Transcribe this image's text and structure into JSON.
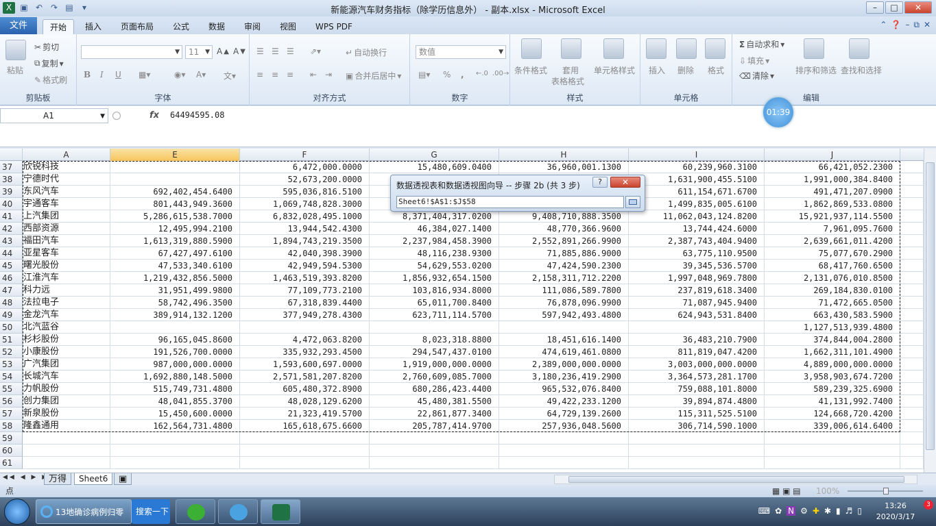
{
  "window": {
    "title": "新能源汽车财务指标（除学历信息外） - 副本.xlsx - Microsoft Excel",
    "min": "–",
    "max": "□",
    "close": "✕"
  },
  "ribbon_tabs": [
    "文件",
    "开始",
    "插入",
    "页面布局",
    "公式",
    "数据",
    "审阅",
    "视图",
    "WPS PDF"
  ],
  "ribbon": {
    "clipboard": {
      "label": "剪贴板",
      "paste": "粘贴",
      "cut": "剪切",
      "copy": "复制",
      "format_painter": "格式刷"
    },
    "font": {
      "label": "字体",
      "size": "11",
      "bold": "B",
      "italic": "I",
      "underline": "U"
    },
    "alignment": {
      "label": "对齐方式",
      "wrap": "自动换行",
      "merge": "合并后居中"
    },
    "number": {
      "label": "数字",
      "format": "数值",
      "percent": "%",
      "comma": ","
    },
    "styles": {
      "label": "样式",
      "conditional": "条件格式",
      "table_1": "套用",
      "table_2": "表格格式",
      "cell_styles": "单元格样式"
    },
    "cells": {
      "label": "单元格",
      "insert": "插入",
      "delete": "删除",
      "format": "格式"
    },
    "editing": {
      "label": "编辑",
      "autosum": "自动求和",
      "fill": "填充",
      "clear": "清除",
      "sort": "排序和筛选",
      "find": "查找和选择"
    }
  },
  "formula_bar": {
    "name_box": "A1",
    "fx": "fx",
    "value": "64494595.08"
  },
  "timer": "01:39",
  "columns": [
    "A",
    "E",
    "F",
    "G",
    "H",
    "I",
    "J"
  ],
  "rows": [
    {
      "n": "37",
      "name": "欣锐科技",
      "E": "",
      "F": "6,472,000.0000",
      "G": "15,480,609.0400",
      "H": "36,960,001.1300",
      "I": "60,239,960.3100",
      "J": "66,421,052.2300"
    },
    {
      "n": "38",
      "name": "宁德时代",
      "E": "",
      "F": "52,673,200.0000",
      "G": "",
      "H": "",
      "I": "1,631,900,455.5100",
      "J": "1,991,000,384.8400"
    },
    {
      "n": "39",
      "name": "东风汽车",
      "E": "692,402,454.6400",
      "F": "595,036,816.5100",
      "G": "",
      "H": "",
      "I": "611,154,671.6700",
      "J": "491,471,207.0900"
    },
    {
      "n": "40",
      "name": "宇通客车",
      "E": "801,443,949.3600",
      "F": "1,069,748,828.3000",
      "G": "",
      "H": "",
      "I": "1,499,835,005.6100",
      "J": "1,862,869,533.0800"
    },
    {
      "n": "41",
      "name": "上汽集团",
      "E": "5,286,615,538.7000",
      "F": "6,832,028,495.1000",
      "G": "8,371,404,317.0200",
      "H": "9,408,710,888.3500",
      "I": "11,062,043,124.8200",
      "J": "15,921,937,114.5500"
    },
    {
      "n": "42",
      "name": "西部资源",
      "E": "12,495,994.2100",
      "F": "13,944,542.4300",
      "G": "46,384,027.1400",
      "H": "48,770,366.9600",
      "I": "13,744,424.6000",
      "J": "7,961,095.7600"
    },
    {
      "n": "43",
      "name": "福田汽车",
      "E": "1,613,319,880.5900",
      "F": "1,894,743,219.3500",
      "G": "2,237,984,458.3900",
      "H": "2,552,891,266.9900",
      "I": "2,387,743,404.9400",
      "J": "2,639,661,011.4200"
    },
    {
      "n": "44",
      "name": "亚星客车",
      "E": "67,427,497.6100",
      "F": "42,040,398.3900",
      "G": "48,116,238.9300",
      "H": "71,885,886.9000",
      "I": "63,775,110.9500",
      "J": "75,077,670.2900"
    },
    {
      "n": "45",
      "name": "曙光股份",
      "E": "47,533,340.6100",
      "F": "42,949,594.5300",
      "G": "54,629,553.0200",
      "H": "47,424,590.2300",
      "I": "39,345,536.5700",
      "J": "68,417,760.6500"
    },
    {
      "n": "46",
      "name": "江淮汽车",
      "E": "1,219,432,856.5000",
      "F": "1,463,519,393.8200",
      "G": "1,856,932,654.1500",
      "H": "2,158,311,712.2200",
      "I": "1,997,048,969.7800",
      "J": "2,131,076,010.8500"
    },
    {
      "n": "47",
      "name": "科力远",
      "E": "31,951,499.9800",
      "F": "77,109,773.2100",
      "G": "103,816,934.8000",
      "H": "111,086,589.7800",
      "I": "237,819,618.3400",
      "J": "269,184,830.0100"
    },
    {
      "n": "48",
      "name": "法拉电子",
      "E": "58,742,496.3500",
      "F": "67,318,839.4400",
      "G": "65,011,700.8400",
      "H": "76,878,096.9900",
      "I": "71,087,945.9400",
      "J": "71,472,665.0500"
    },
    {
      "n": "49",
      "name": "金龙汽车",
      "E": "389,914,132.1200",
      "F": "377,949,278.4300",
      "G": "623,711,114.5700",
      "H": "597,942,493.4800",
      "I": "624,943,531.8400",
      "J": "663,430,583.5900"
    },
    {
      "n": "50",
      "name": "北汽蓝谷",
      "E": "",
      "F": "",
      "G": "",
      "H": "",
      "I": "",
      "J": "1,127,513,939.4800"
    },
    {
      "n": "51",
      "name": "杉杉股份",
      "E": "96,165,045.8600",
      "F": "4,472,063.8200",
      "G": "8,023,318.8800",
      "H": "18,451,616.1400",
      "I": "36,483,210.7900",
      "J": "374,844,004.2800"
    },
    {
      "n": "52",
      "name": "小康股份",
      "E": "191,526,700.0000",
      "F": "335,932,293.4500",
      "G": "294,547,437.0100",
      "H": "474,619,461.0800",
      "I": "811,819,047.4200",
      "J": "1,662,311,101.4900"
    },
    {
      "n": "53",
      "name": "广汽集团",
      "E": "987,000,000.0000",
      "F": "1,593,600,697.0000",
      "G": "1,919,000,000.0000",
      "H": "2,389,000,000.0000",
      "I": "3,003,000,000.0000",
      "J": "4,889,000,000.0000"
    },
    {
      "n": "54",
      "name": "长城汽车",
      "E": "1,692,880,148.5000",
      "F": "2,571,581,207.8200",
      "G": "2,760,609,085.7000",
      "H": "3,180,236,419.2900",
      "I": "3,364,573,281.1700",
      "J": "3,958,903,674.7200"
    },
    {
      "n": "55",
      "name": "力帆股份",
      "E": "515,749,731.4800",
      "F": "605,480,372.8900",
      "G": "680,286,423.4400",
      "H": "965,532,076.8400",
      "I": "759,088,101.8000",
      "J": "589,239,325.6900"
    },
    {
      "n": "56",
      "name": "创力集团",
      "E": "48,041,855.3700",
      "F": "48,028,129.6200",
      "G": "45,480,381.5500",
      "H": "49,422,233.1200",
      "I": "39,894,874.4800",
      "J": "41,131,992.7400"
    },
    {
      "n": "57",
      "name": "新泉股份",
      "E": "15,450,600.0000",
      "F": "21,323,419.5700",
      "G": "22,861,877.3400",
      "H": "64,729,139.2600",
      "I": "115,311,525.5100",
      "J": "124,668,720.4200"
    },
    {
      "n": "58",
      "name": "隆鑫通用",
      "E": "162,564,731.4800",
      "F": "165,618,675.6600",
      "G": "205,787,414.9700",
      "H": "257,936,048.5600",
      "I": "306,714,590.1000",
      "J": "339,006,614.6400"
    },
    {
      "n": "59",
      "name": "",
      "E": "",
      "F": "",
      "G": "",
      "H": "",
      "I": "",
      "J": ""
    },
    {
      "n": "60",
      "name": "",
      "E": "",
      "F": "",
      "G": "",
      "H": "",
      "I": "",
      "J": ""
    },
    {
      "n": "61",
      "name": "",
      "E": "",
      "F": "",
      "G": "",
      "H": "",
      "I": "",
      "J": ""
    }
  ],
  "sheets": [
    "万得",
    "Sheet6"
  ],
  "status": {
    "ready": "点",
    "zoom": "100%"
  },
  "dialog": {
    "title": "数据透视表和数据透视图向导 -- 步骤 2b (共 3 步)",
    "help": "?",
    "close": "✕",
    "range": "Sheet6!$A$1:$J$58"
  },
  "taskbar": {
    "ie_label": "13地确诊病例归零",
    "search_label": "搜索一下",
    "time": "13:26",
    "date": "2020/3/17",
    "badge": "3"
  },
  "colors": {
    "accent": "#2a62ae",
    "selected_header": "#f6c45b",
    "excel_green": "#1f7244"
  }
}
